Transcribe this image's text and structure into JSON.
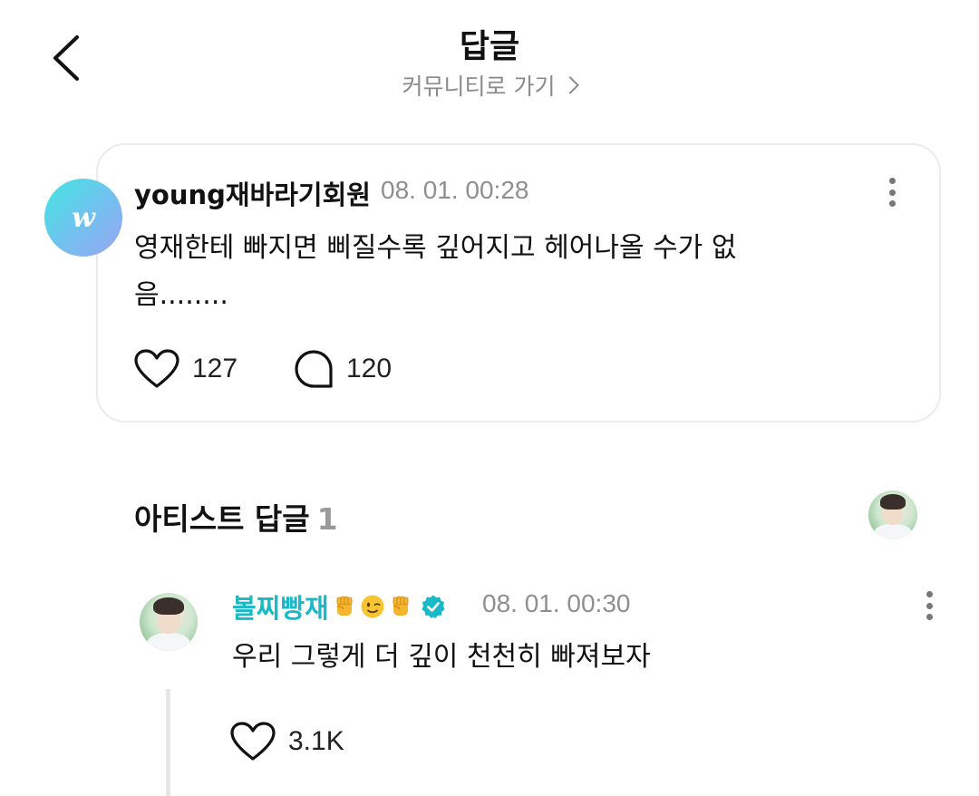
{
  "header": {
    "title": "답글",
    "community_link": "커뮤니티로 가기"
  },
  "comment": {
    "avatar_letter": "w",
    "author": "young재바라기회원",
    "time": "08. 01. 00:28",
    "body": "영재한테 빠지면 삐질수록 깊어지고 헤어나올 수가 없음........",
    "likes": "127",
    "replies": "120"
  },
  "artist_section": {
    "title": "아티스트 답글",
    "count": "1"
  },
  "reply": {
    "author": "볼찌빵재",
    "emojis": [
      "raised-fist",
      "winking-face",
      "raised-fist"
    ],
    "verified": true,
    "time": "08. 01. 00:30",
    "body": "우리 그렇게 더 깊이 천천히 빠져보자",
    "likes": "3.1K"
  },
  "colors": {
    "artist_name": "#1ab9c7",
    "muted_text": "#8f8f8f",
    "card_border": "#ececec"
  }
}
